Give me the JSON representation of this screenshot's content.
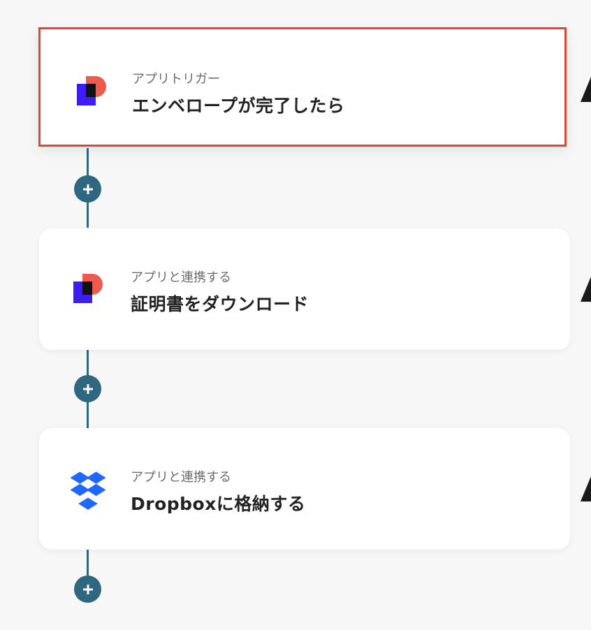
{
  "steps": [
    {
      "type_label": "アプリトリガー",
      "title": "エンベロープが完了したら",
      "app_icon": "docusign-d-logo-icon",
      "selected": true
    },
    {
      "type_label": "アプリと連携する",
      "title": "証明書をダウンロード",
      "app_icon": "docusign-d-logo-icon",
      "selected": false
    },
    {
      "type_label": "アプリと連携する",
      "title": "Dropboxに格納する",
      "app_icon": "dropbox-logo-icon",
      "selected": false
    }
  ],
  "add_step_icon": "plus-icon",
  "colors": {
    "connector": "#2f6680",
    "selected_border": "#e2452f",
    "docusign_red": "#ef5a4f",
    "docusign_blue": "#3e1cf5",
    "dropbox_blue": "#1f68ff"
  }
}
